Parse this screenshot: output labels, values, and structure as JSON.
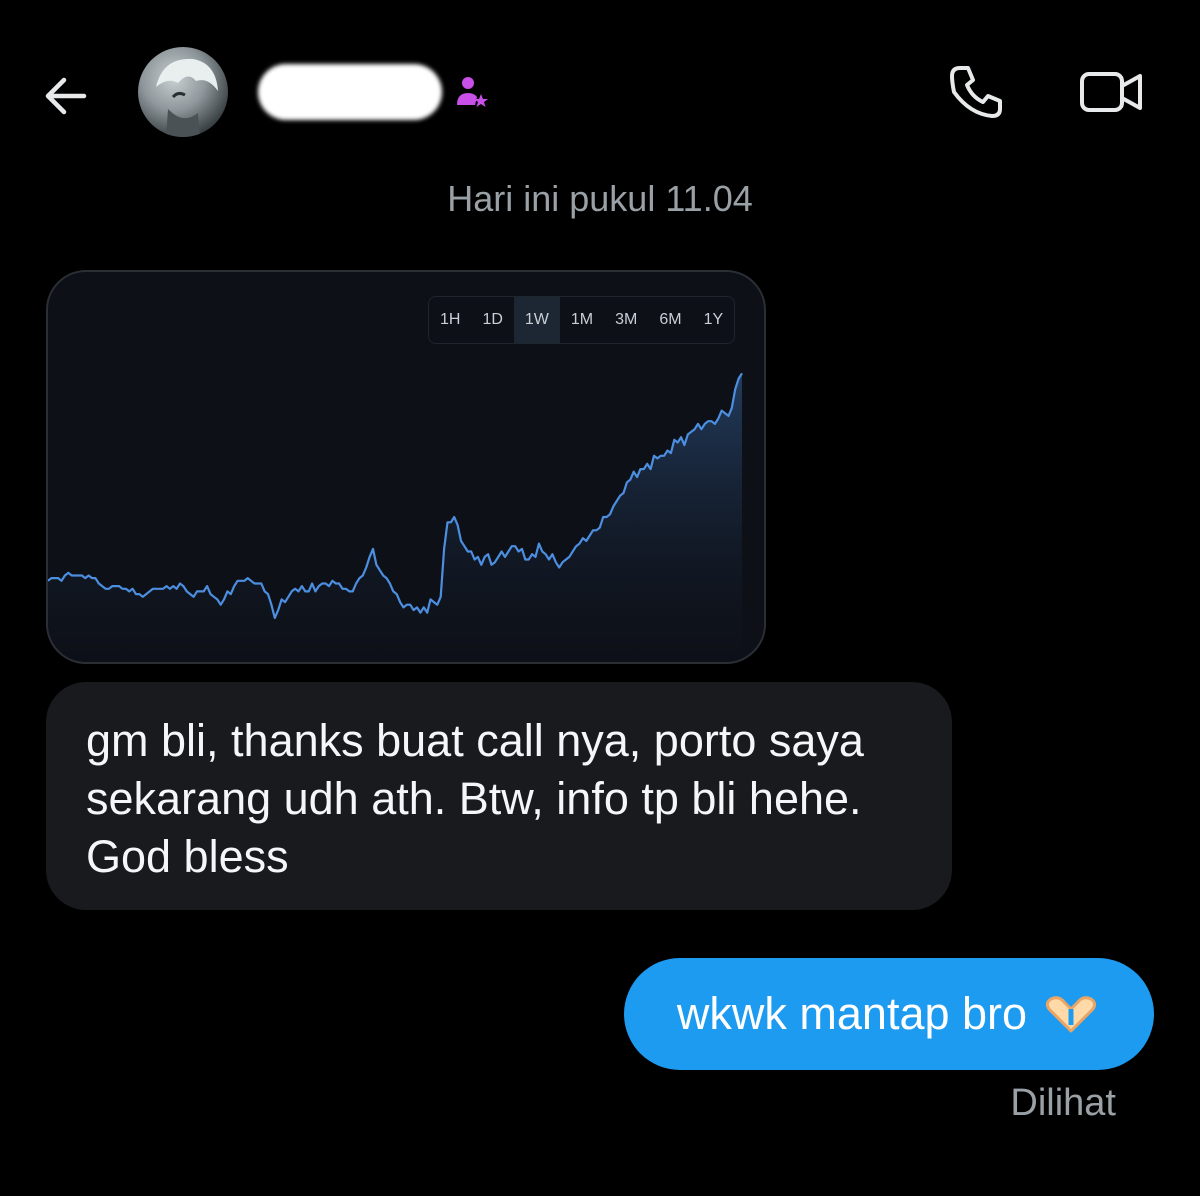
{
  "header": {
    "back_icon": "arrow-left-icon",
    "avatar_icon": "user-avatar",
    "badge_icon": "user-star-icon",
    "call_icon": "phone-icon",
    "video_icon": "video-camera-icon"
  },
  "conversation": {
    "timestamp": "Hari ini pukul 11.04",
    "incoming_text": "gm bli, thanks buat call nya, porto saya sekarang udh ath. Btw, info tp bli hehe. God bless",
    "outgoing_text": "wkwk mantap bro",
    "outgoing_emoji_icon": "heart-hands-icon",
    "seen_status": "Dilihat"
  },
  "chart_card": {
    "range_tabs": [
      "1H",
      "1D",
      "1W",
      "1M",
      "3M",
      "6M",
      "1Y"
    ],
    "active_tab": "1W"
  },
  "colors": {
    "background": "#000000",
    "incoming_bubble": "#181a1d",
    "outgoing_bubble": "#1d9bf0",
    "line": "#4c8fe0",
    "badge": "#c84fe8"
  },
  "chart_data": {
    "type": "area",
    "title": "",
    "xlabel": "",
    "ylabel": "",
    "ylim": [
      0,
      100
    ],
    "values": [
      20,
      21,
      21,
      21,
      20,
      22,
      23,
      22,
      22,
      22,
      22,
      21,
      22,
      21,
      21,
      19,
      18,
      17,
      17,
      18,
      18,
      18,
      17,
      17,
      16,
      17,
      15,
      15,
      14,
      15,
      16,
      17,
      17,
      17,
      17,
      18,
      17,
      18,
      17,
      19,
      18,
      16,
      15,
      14,
      16,
      16,
      16,
      18,
      15,
      14,
      13,
      11,
      13,
      16,
      15,
      18,
      20,
      20,
      20,
      21,
      20,
      19,
      19,
      19,
      16,
      15,
      11,
      6,
      9,
      13,
      12,
      14,
      16,
      17,
      16,
      18,
      16,
      16,
      19,
      16,
      18,
      19,
      19,
      18,
      20,
      19,
      19,
      17,
      17,
      16,
      16,
      19,
      21,
      22,
      25,
      29,
      32,
      26,
      24,
      22,
      21,
      19,
      16,
      15,
      12,
      10,
      11,
      11,
      9,
      10,
      8,
      10,
      8,
      13,
      12,
      11,
      14,
      32,
      42,
      42,
      44,
      41,
      35,
      33,
      31,
      31,
      28,
      29,
      26,
      29,
      30,
      26,
      27,
      29,
      31,
      29,
      31,
      33,
      33,
      31,
      32,
      28,
      28,
      30,
      29,
      34,
      31,
      30,
      28,
      30,
      27,
      25,
      27,
      28,
      29,
      31,
      33,
      34,
      36,
      35,
      37,
      39,
      39,
      40,
      44,
      44,
      45,
      48,
      50,
      52,
      53,
      57,
      58,
      61,
      59,
      62,
      62,
      64,
      62,
      67,
      66,
      67,
      67,
      69,
      68,
      73,
      72,
      74,
      71,
      75,
      76,
      77,
      79,
      77,
      79,
      80,
      80,
      79,
      81,
      84,
      83,
      82,
      85,
      92,
      96,
      98
    ]
  }
}
